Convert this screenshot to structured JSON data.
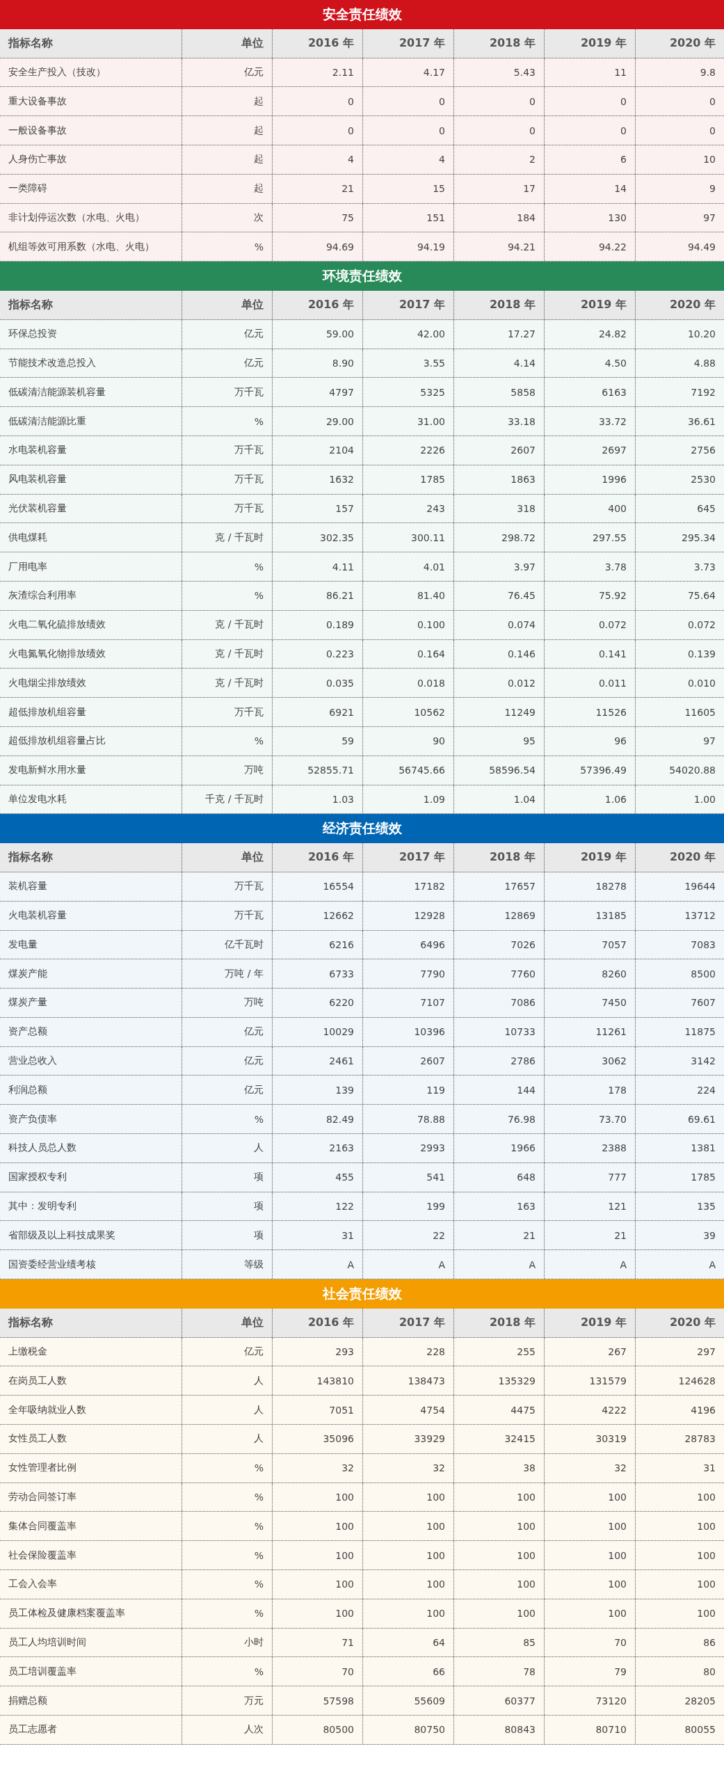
{
  "sections": [
    {
      "title": "安全责任绩效",
      "color": "#d0121b",
      "columns": [
        "指标名称",
        "单位",
        "2016 年",
        "2017 年",
        "2018 年",
        "2019 年",
        "2020 年"
      ],
      "rows": [
        [
          "安全生产投入（技改）",
          "亿元",
          "2.11",
          "4.17",
          "5.43",
          "11",
          "9.8"
        ],
        [
          "重大设备事故",
          "起",
          "0",
          "0",
          "0",
          "0",
          "0"
        ],
        [
          "一般设备事故",
          "起",
          "0",
          "0",
          "0",
          "0",
          "0"
        ],
        [
          "人身伤亡事故",
          "起",
          "4",
          "4",
          "2",
          "6",
          "10"
        ],
        [
          "一类障碍",
          "起",
          "21",
          "15",
          "17",
          "14",
          "9"
        ],
        [
          "非计划停运次数（水电、火电）",
          "次",
          "75",
          "151",
          "184",
          "130",
          "97"
        ],
        [
          "机组等效可用系数（水电、火电）",
          "%",
          "94.69",
          "94.19",
          "94.21",
          "94.22",
          "94.49"
        ]
      ]
    },
    {
      "title": "环境责任绩效",
      "color": "#278a58",
      "columns": [
        "指标名称",
        "单位",
        "2016 年",
        "2017 年",
        "2018 年",
        "2019 年",
        "2020 年"
      ],
      "rows": [
        [
          "环保总投资",
          "亿元",
          "59.00",
          "42.00",
          "17.27",
          "24.82",
          "10.20"
        ],
        [
          "节能技术改造总投入",
          "亿元",
          "8.90",
          "3.55",
          "4.14",
          "4.50",
          "4.88"
        ],
        [
          "低碳清洁能源装机容量",
          "万千瓦",
          "4797",
          "5325",
          "5858",
          "6163",
          "7192"
        ],
        [
          "低碳清洁能源比重",
          "%",
          "29.00",
          "31.00",
          "33.18",
          "33.72",
          "36.61"
        ],
        [
          "水电装机容量",
          "万千瓦",
          "2104",
          "2226",
          "2607",
          "2697",
          "2756"
        ],
        [
          "风电装机容量",
          "万千瓦",
          "1632",
          "1785",
          "1863",
          "1996",
          "2530"
        ],
        [
          "光伏装机容量",
          "万千瓦",
          "157",
          "243",
          "318",
          "400",
          "645"
        ],
        [
          "供电煤耗",
          "克 / 千瓦时",
          "302.35",
          "300.11",
          "298.72",
          "297.55",
          "295.34"
        ],
        [
          "厂用电率",
          "%",
          "4.11",
          "4.01",
          "3.97",
          "3.78",
          "3.73"
        ],
        [
          "灰渣综合利用率",
          "%",
          "86.21",
          "81.40",
          "76.45",
          "75.92",
          "75.64"
        ],
        [
          "火电二氧化硫排放绩效",
          "克 / 千瓦时",
          "0.189",
          "0.100",
          "0.074",
          "0.072",
          "0.072"
        ],
        [
          "火电氮氧化物排放绩效",
          "克 / 千瓦时",
          "0.223",
          "0.164",
          "0.146",
          "0.141",
          "0.139"
        ],
        [
          "火电烟尘排放绩效",
          "克 / 千瓦时",
          "0.035",
          "0.018",
          "0.012",
          "0.011",
          "0.010"
        ],
        [
          "超低排放机组容量",
          "万千瓦",
          "6921",
          "10562",
          "11249",
          "11526",
          "11605"
        ],
        [
          "超低排放机组容量占比",
          "%",
          "59",
          "90",
          "95",
          "96",
          "97"
        ],
        [
          "发电新鲜水用水量",
          "万吨",
          "52855.71",
          "56745.66",
          "58596.54",
          "57396.49",
          "54020.88"
        ],
        [
          "单位发电水耗",
          "千克 / 千瓦时",
          "1.03",
          "1.09",
          "1.04",
          "1.06",
          "1.00"
        ]
      ]
    },
    {
      "title": "经济责任绩效",
      "color": "#0066b3",
      "columns": [
        "指标名称",
        "单位",
        "2016 年",
        "2017 年",
        "2018 年",
        "2019 年",
        "2020 年"
      ],
      "rows": [
        [
          "装机容量",
          "万千瓦",
          "16554",
          "17182",
          "17657",
          "18278",
          "19644"
        ],
        [
          "火电装机容量",
          "万千瓦",
          "12662",
          "12928",
          "12869",
          "13185",
          "13712"
        ],
        [
          "发电量",
          "亿千瓦时",
          "6216",
          "6496",
          "7026",
          "7057",
          "7083"
        ],
        [
          "煤炭产能",
          "万吨 / 年",
          "6733",
          "7790",
          "7760",
          "8260",
          "8500"
        ],
        [
          "煤炭产量",
          "万吨",
          "6220",
          "7107",
          "7086",
          "7450",
          "7607"
        ],
        [
          "资产总额",
          "亿元",
          "10029",
          "10396",
          "10733",
          "11261",
          "11875"
        ],
        [
          "营业总收入",
          "亿元",
          "2461",
          "2607",
          "2786",
          "3062",
          "3142"
        ],
        [
          "利润总额",
          "亿元",
          "139",
          "119",
          "144",
          "178",
          "224"
        ],
        [
          "资产负债率",
          "%",
          "82.49",
          "78.88",
          "76.98",
          "73.70",
          "69.61"
        ],
        [
          "科技人员总人数",
          "人",
          "2163",
          "2993",
          "1966",
          "2388",
          "1381"
        ],
        [
          "国家授权专利",
          "项",
          "455",
          "541",
          "648",
          "777",
          "1785"
        ],
        [
          "其中：发明专利",
          "项",
          "122",
          "199",
          "163",
          "121",
          "135"
        ],
        [
          "省部级及以上科技成果奖",
          "项",
          "31",
          "22",
          "21",
          "21",
          "39"
        ],
        [
          "国资委经营业绩考核",
          "等级",
          "A",
          "A",
          "A",
          "A",
          "A"
        ]
      ]
    },
    {
      "title": "社会责任绩效",
      "color": "#f39d00",
      "columns": [
        "指标名称",
        "单位",
        "2016 年",
        "2017 年",
        "2018 年",
        "2019 年",
        "2020 年"
      ],
      "rows": [
        [
          "上缴税金",
          "亿元",
          "293",
          "228",
          "255",
          "267",
          "297"
        ],
        [
          "在岗员工人数",
          "人",
          "143810",
          "138473",
          "135329",
          "131579",
          "124628"
        ],
        [
          "全年吸纳就业人数",
          "人",
          "7051",
          "4754",
          "4475",
          "4222",
          "4196"
        ],
        [
          "女性员工人数",
          "人",
          "35096",
          "33929",
          "32415",
          "30319",
          "28783"
        ],
        [
          "女性管理者比例",
          "%",
          "32",
          "32",
          "38",
          "32",
          "31"
        ],
        [
          "劳动合同签订率",
          "%",
          "100",
          "100",
          "100",
          "100",
          "100"
        ],
        [
          "集体合同覆盖率",
          "%",
          "100",
          "100",
          "100",
          "100",
          "100"
        ],
        [
          "社会保险覆盖率",
          "%",
          "100",
          "100",
          "100",
          "100",
          "100"
        ],
        [
          "工会入会率",
          "%",
          "100",
          "100",
          "100",
          "100",
          "100"
        ],
        [
          "员工体检及健康档案覆盖率",
          "%",
          "100",
          "100",
          "100",
          "100",
          "100"
        ],
        [
          "员工人均培训时间",
          "小时",
          "71",
          "64",
          "85",
          "70",
          "86"
        ],
        [
          "员工培训覆盖率",
          "%",
          "70",
          "66",
          "78",
          "79",
          "80"
        ],
        [
          "捐赠总额",
          "万元",
          "57598",
          "55609",
          "60377",
          "73120",
          "28205"
        ],
        [
          "员工志愿者",
          "人次",
          "80500",
          "80750",
          "80843",
          "80710",
          "80055"
        ]
      ]
    }
  ]
}
